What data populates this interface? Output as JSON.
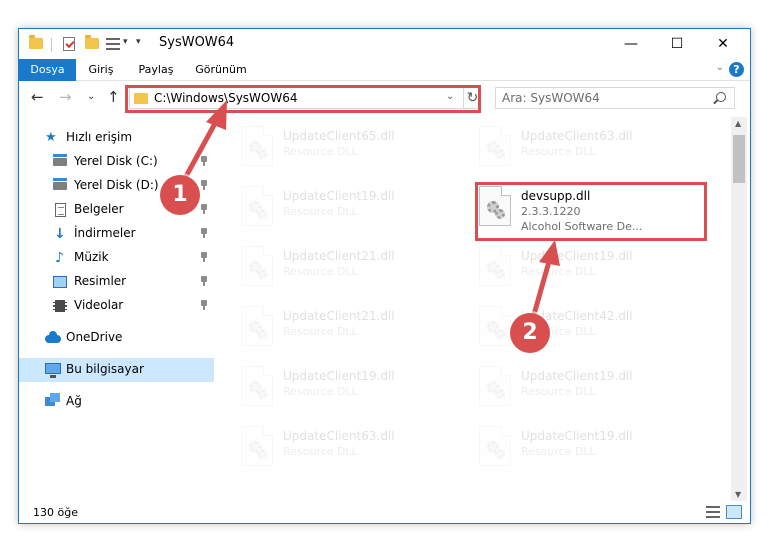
{
  "window": {
    "title": "SysWOW64"
  },
  "ribbon": {
    "tabs": [
      "Dosya",
      "Giriş",
      "Paylaş",
      "Görünüm"
    ]
  },
  "address": {
    "path": "C:\\Windows\\SysWOW64"
  },
  "search": {
    "placeholder": "Ara: SysWOW64"
  },
  "sidebar": {
    "items": [
      {
        "label": "Hızlı erişim",
        "icon": "star-icon"
      },
      {
        "label": "Yerel Disk (C:)",
        "icon": "disk-icon"
      },
      {
        "label": "Yerel Disk (D:)",
        "icon": "disk-icon"
      },
      {
        "label": "Belgeler",
        "icon": "document-icon"
      },
      {
        "label": "İndirmeler",
        "icon": "download-icon"
      },
      {
        "label": "Müzik",
        "icon": "music-icon"
      },
      {
        "label": "Resimler",
        "icon": "pictures-icon"
      },
      {
        "label": "Videolar",
        "icon": "videos-icon"
      },
      {
        "label": "OneDrive",
        "icon": "cloud-icon"
      },
      {
        "label": "Bu bilgisayar",
        "icon": "computer-icon"
      },
      {
        "label": "Ağ",
        "icon": "network-icon"
      }
    ]
  },
  "files": {
    "left": [
      {
        "name": "UpdateClient65.dll",
        "desc": "Resource DLL"
      },
      {
        "name": "UpdateClient19.dll",
        "desc": "Resource DLL"
      },
      {
        "name": "UpdateClient21.dll",
        "desc": "Resource DLL"
      },
      {
        "name": "UpdateClient21.dll",
        "desc": "Resource DLL"
      },
      {
        "name": "UpdateClient19.dll",
        "desc": "Resource DLL"
      },
      {
        "name": "UpdateClient63.dll",
        "desc": "Resource DLL"
      }
    ],
    "right": [
      {
        "name": "UpdateClient63.dll",
        "desc": "Resource DLL"
      },
      {
        "name": "UpdateClient19.dll",
        "desc": "Resource DLL"
      },
      {
        "name": "UpdateClient42.dll",
        "desc": "Resource DLL"
      },
      {
        "name": "UpdateClient19.dll",
        "desc": "Resource DLL"
      },
      {
        "name": "UpdateClient19.dll",
        "desc": "Resource DLL"
      }
    ],
    "highlighted": {
      "name": "devsupp.dll",
      "version": "2.3.3.1220",
      "company": "Alcohol Software De..."
    }
  },
  "status": {
    "count": "130 öğe"
  },
  "annotations": {
    "badge1": "1",
    "badge2": "2",
    "color": "#d94f4f"
  },
  "colors": {
    "accent": "#1979ca"
  }
}
